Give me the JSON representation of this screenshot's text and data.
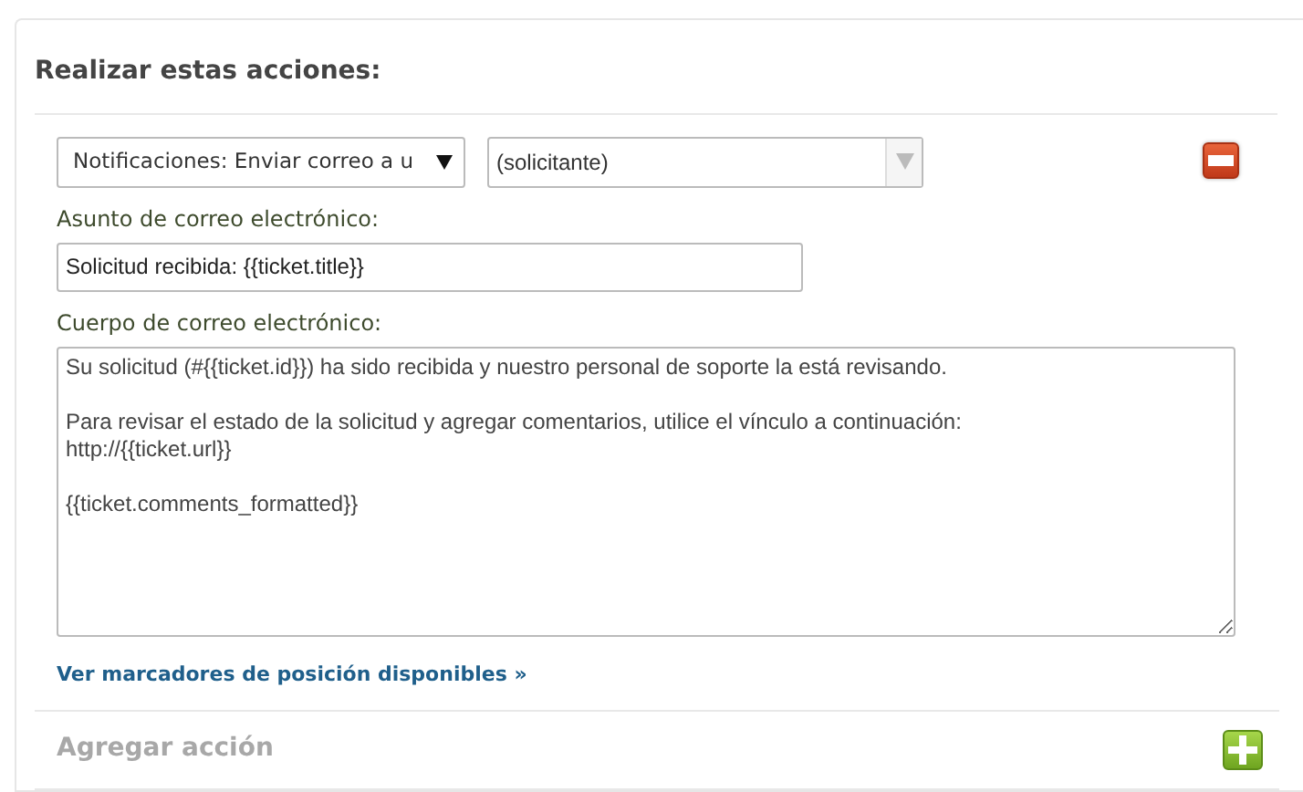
{
  "section_title": "Realizar estas acciones:",
  "action": {
    "type_select": "Notificaciones: Enviar correo a u",
    "recipient": "(solicitante)",
    "recipient_disabled": true,
    "subject_label": "Asunto de correo electrónico:",
    "subject": "Solicitud recibida: {{ticket.title}}",
    "body_label": "Cuerpo de correo electrónico:",
    "body": "Su solicitud (#{{ticket.id}}) ha sido recibida y nuestro personal de soporte la está revisando.\n\nPara revisar el estado de la solicitud y agregar comentarios, utilice el vínculo a continuación:\nhttp://{{ticket.url}}\n\n{{ticket.comments_formatted}}",
    "placeholders_link": "Ver marcadores de posición disponibles »"
  },
  "add_action": {
    "label": "Agregar acción",
    "disabled": true
  }
}
